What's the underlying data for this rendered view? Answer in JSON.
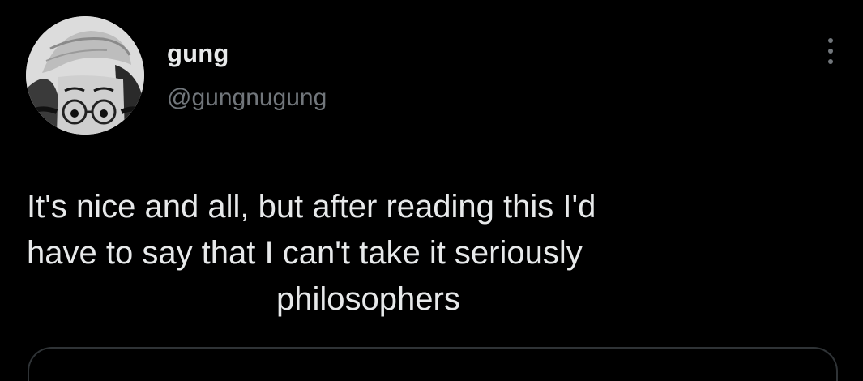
{
  "user": {
    "display_name": "gung",
    "handle": "@gungnugung",
    "avatar_icon": "profile-photo"
  },
  "tweet": {
    "line1": "It's nice and all, but after reading this I'd\nhave to say that I can't take it seriously",
    "line2": "philosophers"
  },
  "actions": {
    "more_icon": "vertical-ellipsis-icon"
  },
  "colors": {
    "background": "#000000",
    "text_primary": "#e7e9ea",
    "text_secondary": "#71767b",
    "border": "#2f3336"
  }
}
